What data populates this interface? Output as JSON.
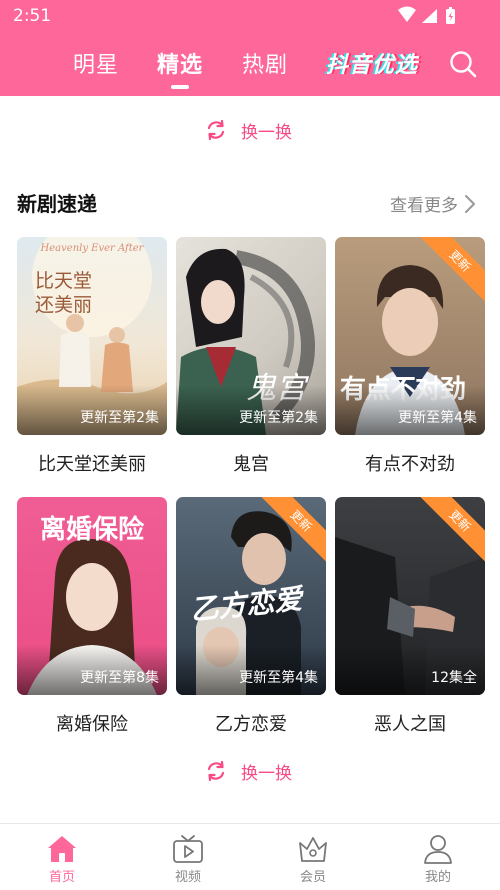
{
  "status_bar": {
    "time": "2:51"
  },
  "top_nav": {
    "tabs": [
      {
        "label": "明星",
        "active": false
      },
      {
        "label": "精选",
        "active": true
      },
      {
        "label": "热剧",
        "active": false
      }
    ],
    "logo_text": "抖音优选",
    "icons": {
      "search": "search-icon"
    }
  },
  "refresh_label": "换一换",
  "section": {
    "title": "新剧速递",
    "more_label": "查看更多"
  },
  "cards": [
    {
      "title": "比天堂还美丽",
      "status": "更新至第2集",
      "corner_badge": "",
      "poster_text": "比天堂\n还美丽",
      "poster_script": "Heavenly Ever After"
    },
    {
      "title": "鬼宫",
      "status": "更新至第2集",
      "corner_badge": "",
      "poster_text": "鬼宫",
      "poster_script": ""
    },
    {
      "title": "有点不对劲",
      "status": "更新至第4集",
      "corner_badge": "更新",
      "poster_text": "有点不对劲",
      "poster_script": ""
    },
    {
      "title": "离婚保险",
      "status": "更新至第8集",
      "corner_badge": "",
      "poster_text": "离婚保险",
      "poster_script": ""
    },
    {
      "title": "乙方恋爱",
      "status": "更新至第4集",
      "corner_badge": "更新",
      "poster_text": "乙方恋爱",
      "poster_script": ""
    },
    {
      "title": "恶人之国",
      "status": "12集全",
      "corner_badge": "更新",
      "poster_text": "",
      "poster_script": ""
    }
  ],
  "bottom_nav": [
    {
      "label": "首页",
      "icon": "home-icon",
      "active": true
    },
    {
      "label": "视频",
      "icon": "tv-icon",
      "active": false
    },
    {
      "label": "会员",
      "icon": "crown-icon",
      "active": false
    },
    {
      "label": "我的",
      "icon": "user-icon",
      "active": false
    }
  ],
  "colors": {
    "brand_pink": "#fd679a",
    "accent_pink": "#f84b86",
    "badge_orange": "#ff9033"
  }
}
